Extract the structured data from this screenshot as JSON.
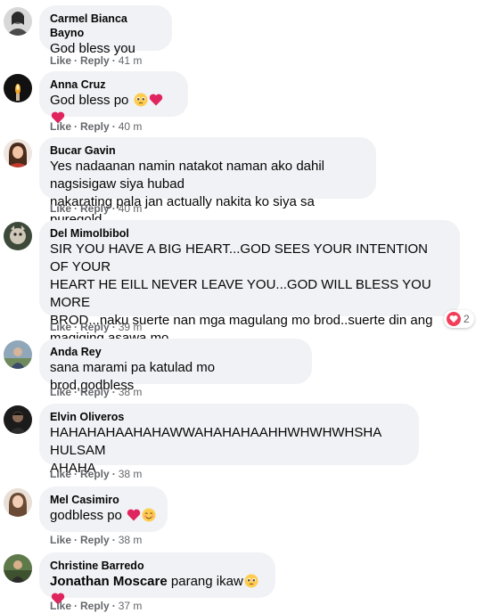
{
  "comments": [
    {
      "author": "Carmel Bianca Bayno",
      "text": "God bless you",
      "like": "Like",
      "reply": "Reply",
      "time": "41 m",
      "avatar": "avatar-carmel"
    },
    {
      "author": "Anna Cruz",
      "text": "God bless po",
      "like": "Like",
      "reply": "Reply",
      "time": "40 m",
      "avatar": "avatar-anna",
      "emoji": [
        "pleading-face",
        "red-heart",
        "red-heart"
      ]
    },
    {
      "author": "Bucar Gavin",
      "text_lines": [
        "Yes nadaanan namin natakot naman ako dahil nagsisigaw siya hubad",
        "nakarating pala jan actually nakita ko siya sa puregold"
      ],
      "like": "Like",
      "reply": "Reply",
      "time": "40 m",
      "avatar": "avatar-bucar"
    },
    {
      "author": "Del Mimolbibol",
      "text_lines": [
        "SIR YOU HAVE A BIG HEART...GOD SEES YOUR INTENTION OF YOUR",
        "HEART HE EILL NEVER LEAVE YOU...GOD WILL BLESS YOU MORE",
        "BROD...naku suerte nan mga magulang mo brod..suerte din ang",
        "magiging asawa mo..."
      ],
      "like": "Like",
      "reply": "Reply",
      "time": "39 m",
      "avatar": "avatar-del",
      "reaction_count": "2"
    },
    {
      "author": "Anda Rey",
      "text": "sana marami pa katulad mo brod,godbless",
      "like": "Like",
      "reply": "Reply",
      "time": "38 m",
      "avatar": "avatar-anda"
    },
    {
      "author": "Elvin Oliveros",
      "text_lines": [
        "HAHAHAHAAHAHAWWAHAHAHAAHHWHWHWHSHA HULSAM",
        "AHAHA"
      ],
      "like": "Like",
      "reply": "Reply",
      "time": "38 m",
      "avatar": "avatar-elvin"
    },
    {
      "author": "Mel Casimiro",
      "text": "godbless po",
      "like": "Like",
      "reply": "Reply",
      "time": "38 m",
      "avatar": "avatar-mel",
      "emoji": [
        "red-heart",
        "smiling-face"
      ]
    },
    {
      "author": "Christine Barredo",
      "mention": "Jonathan Moscare",
      "text": "parang ikaw",
      "like": "Like",
      "reply": "Reply",
      "time": "37 m",
      "avatar": "avatar-christine",
      "emoji": [
        "pleading-face",
        "red-heart"
      ]
    }
  ],
  "colors": {
    "bubble": "#f0f2f5",
    "meta": "#65676b",
    "heart": "#f33e58",
    "emoji_heart": "#e0245e",
    "emoji_face": "#ffcc4d"
  }
}
